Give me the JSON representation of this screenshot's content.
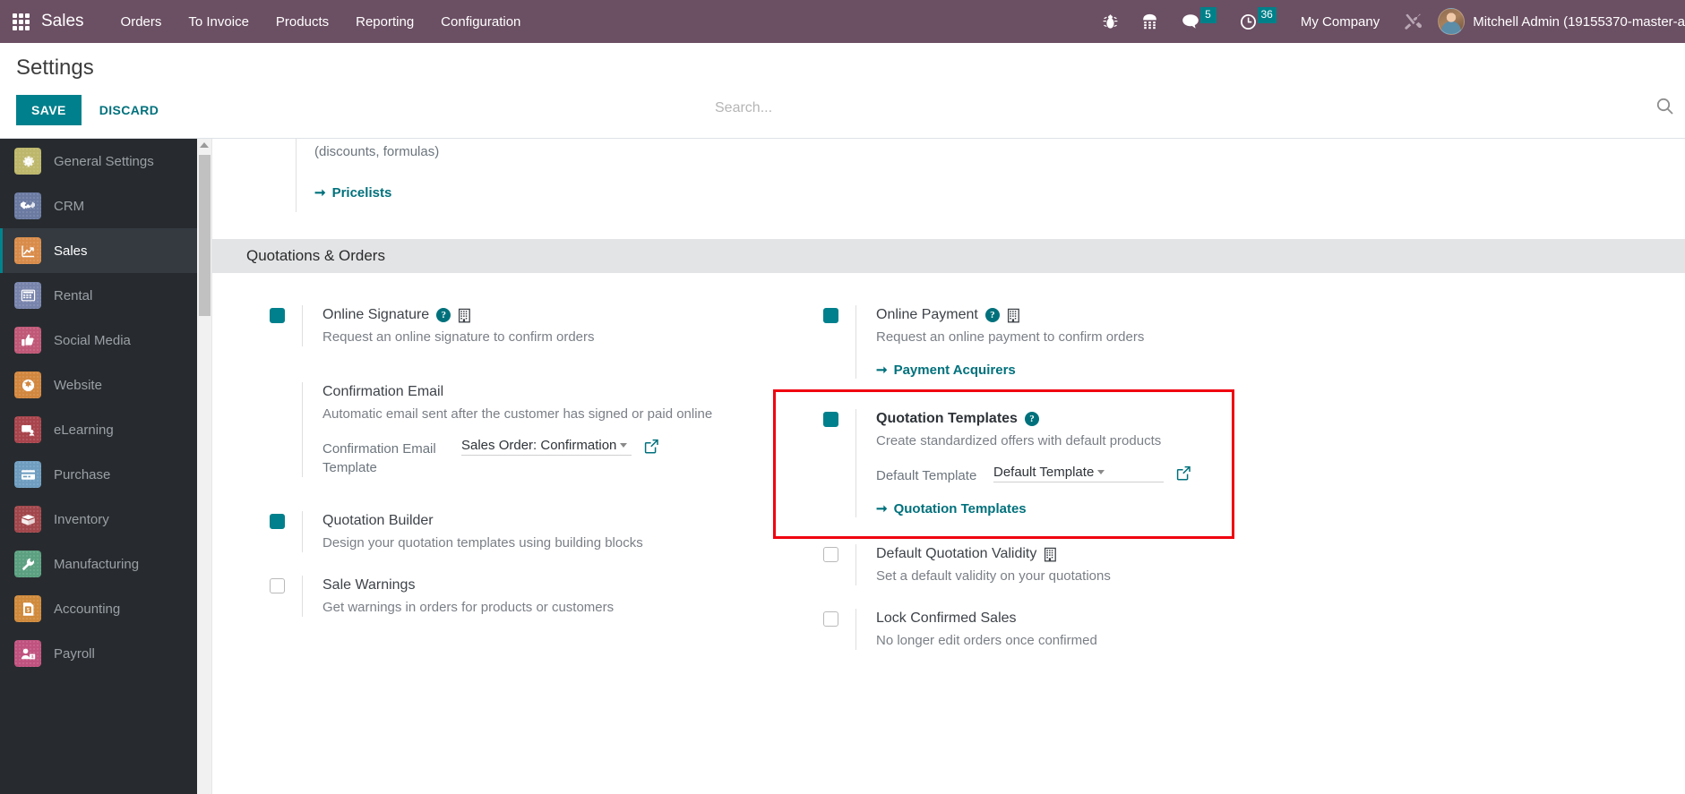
{
  "navbar": {
    "apps_icon": "apps-grid-icon",
    "brand": "Sales",
    "menus": [
      "Orders",
      "To Invoice",
      "Products",
      "Reporting",
      "Configuration"
    ],
    "icons": {
      "debug": "bug-icon",
      "dialpad": "phone-keypad-icon",
      "messages": "chat-bubble-icon",
      "activities": "clock-icon",
      "settings_tools": "tools-icon"
    },
    "messages_count": "5",
    "activities_count": "36",
    "company": "My Company",
    "user": "Mitchell Admin (19155370-master-a"
  },
  "control_panel": {
    "title": "Settings",
    "save_label": "SAVE",
    "discard_label": "DISCARD",
    "search_placeholder": "Search...",
    "search_value": ""
  },
  "sidebar": {
    "items": [
      {
        "label": "General Settings",
        "icon": "gear-icon",
        "color": "#bdb76b",
        "active": false
      },
      {
        "label": "CRM",
        "icon": "handshake-icon",
        "color": "#6b7aa1",
        "active": false
      },
      {
        "label": "Sales",
        "icon": "chart-up-icon",
        "color": "#d98c4a",
        "active": true
      },
      {
        "label": "Rental",
        "icon": "calendar-icon",
        "color": "#7884ac",
        "active": false
      },
      {
        "label": "Social Media",
        "icon": "thumbs-up-icon",
        "color": "#c05878",
        "active": false
      },
      {
        "label": "Website",
        "icon": "globe-icon",
        "color": "#d2873f",
        "active": false
      },
      {
        "label": "eLearning",
        "icon": "elearning-icon",
        "color": "#a8444c",
        "active": false
      },
      {
        "label": "Purchase",
        "icon": "card-icon",
        "color": "#6f9dc0",
        "active": false
      },
      {
        "label": "Inventory",
        "icon": "box-icon",
        "color": "#a1474c",
        "active": false
      },
      {
        "label": "Manufacturing",
        "icon": "wrench-icon",
        "color": "#5ba080",
        "action": false
      },
      {
        "label": "Accounting",
        "icon": "invoice-icon",
        "color": "#d08a3c",
        "active": false
      },
      {
        "label": "Payroll",
        "icon": "payroll-icon",
        "color": "#c0527f",
        "active": false
      }
    ]
  },
  "main": {
    "pricing_fragment": {
      "text": "(discounts, formulas)",
      "link_label": "Pricelists",
      "link_icon": "arrow-right-icon"
    },
    "section": {
      "title": "Quotations & Orders"
    },
    "settings": {
      "online_signature": {
        "title": "Online Signature",
        "desc": "Request an online signature to confirm orders",
        "checked": true,
        "help_icon": "question-mark-icon",
        "company_icon": "building-icon"
      },
      "online_payment": {
        "title": "Online Payment",
        "desc": "Request an online payment to confirm orders",
        "checked": true,
        "help_icon": "question-mark-icon",
        "company_icon": "building-icon",
        "link_label": "Payment Acquirers",
        "link_icon": "arrow-right-icon"
      },
      "confirmation_email": {
        "title": "Confirmation Email",
        "desc": "Automatic email sent after the customer has signed or paid online",
        "field_label": "Confirmation Email Template",
        "field_value": "Sales Order: Confirmation",
        "ext_icon": "external-link-icon"
      },
      "quotation_templates": {
        "title": "Quotation Templates",
        "desc": "Create standardized offers with default products",
        "checked": true,
        "help_icon": "question-mark-icon",
        "field_label": "Default Template",
        "field_value": "Default Template",
        "ext_icon": "external-link-icon",
        "link_label": "Quotation Templates",
        "link_icon": "arrow-right-icon",
        "highlight_color": "#f0000f"
      },
      "quotation_builder": {
        "title": "Quotation Builder",
        "desc": "Design your quotation templates using building blocks",
        "checked": true
      },
      "default_quotation_validity": {
        "title": "Default Quotation Validity",
        "desc": "Set a default validity on your quotations",
        "checked": false,
        "company_icon": "building-icon"
      },
      "sale_warnings": {
        "title": "Sale Warnings",
        "desc": "Get warnings in orders for products or customers",
        "checked": false
      },
      "lock_confirmed_sales": {
        "title": "Lock Confirmed Sales",
        "desc": "No longer edit orders once confirmed",
        "checked": false
      }
    }
  },
  "colors": {
    "navbar": "#6B4F63",
    "accent_teal": "#00808C",
    "sidebar_bg": "#272b2f",
    "section_bg": "#e2e4e6",
    "highlight_red": "#f0000f"
  }
}
